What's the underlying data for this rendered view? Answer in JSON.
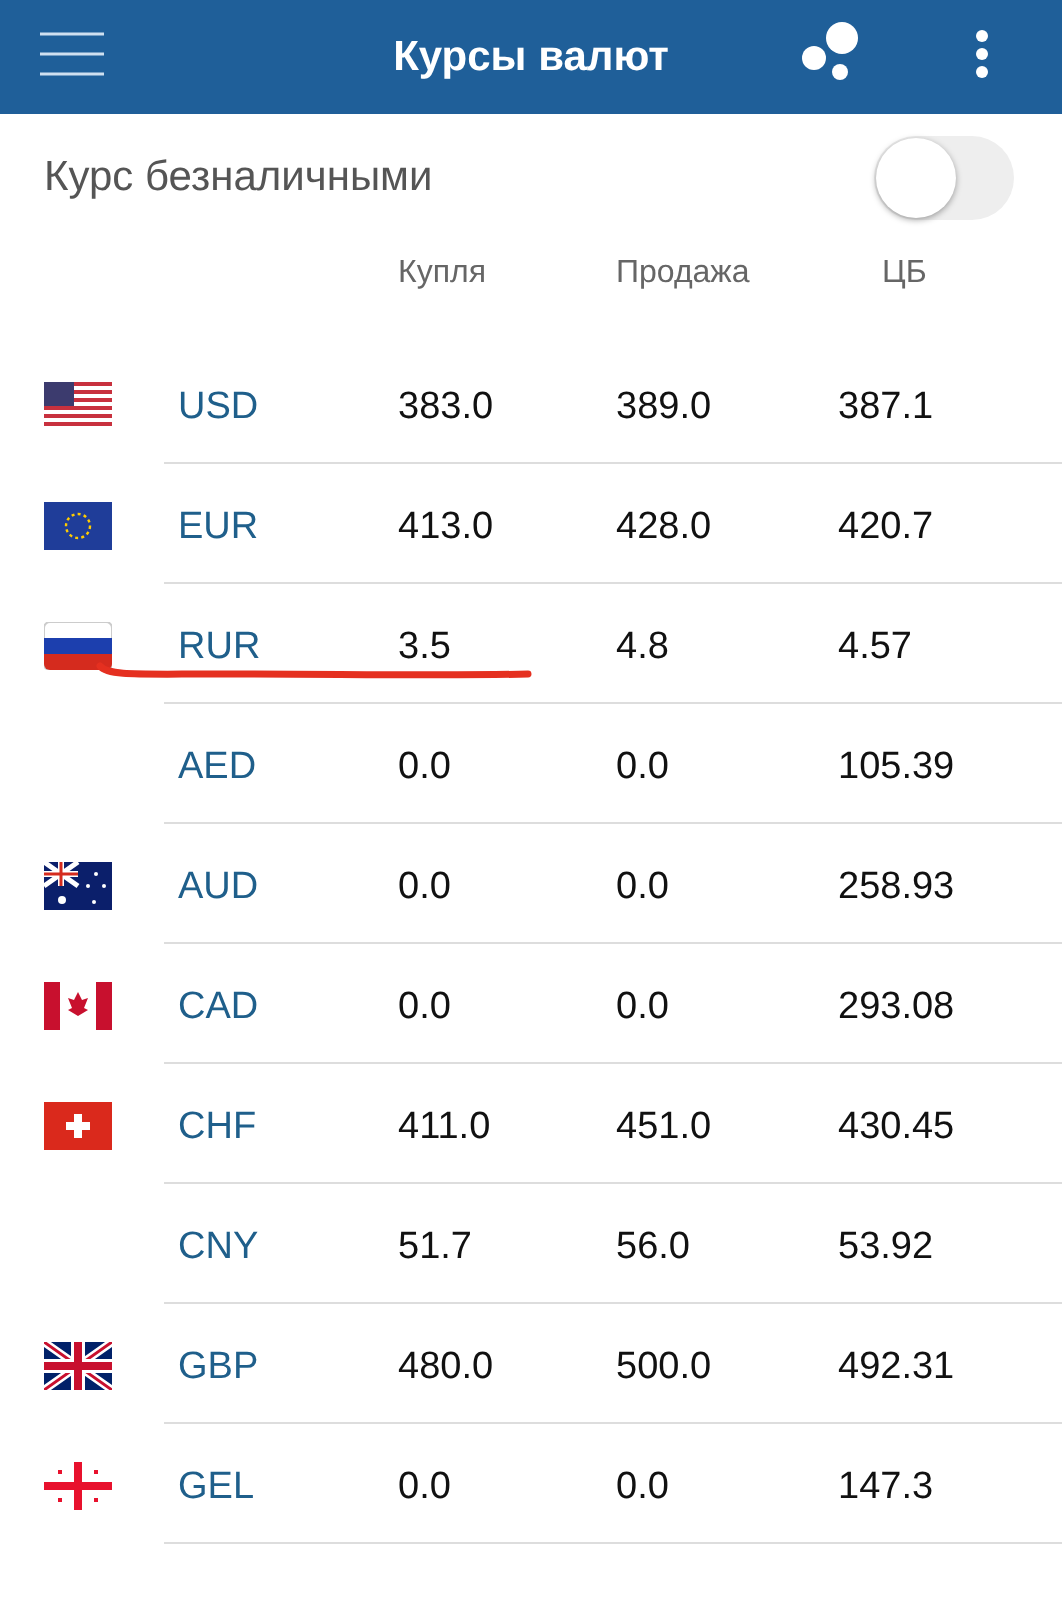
{
  "app_bar": {
    "title": "Курсы валют"
  },
  "cashless_toggle": {
    "label": "Курс безналичными",
    "on": false
  },
  "table": {
    "columns": [
      "Купля",
      "Продажа",
      "ЦБ"
    ],
    "rows": [
      {
        "kind": "us",
        "code": "USD",
        "buy": "383.0",
        "sell": "389.0",
        "cb": "387.1",
        "marked": false
      },
      {
        "kind": "eu",
        "code": "EUR",
        "buy": "413.0",
        "sell": "428.0",
        "cb": "420.7",
        "marked": false
      },
      {
        "kind": "ru",
        "code": "RUR",
        "buy": "3.5",
        "sell": "4.8",
        "cb": "4.57",
        "marked": true
      },
      {
        "code": "AED",
        "buy": "0.0",
        "sell": "0.0",
        "cb": "105.39",
        "marked": false
      },
      {
        "kind": "au",
        "code": "AUD",
        "buy": "0.0",
        "sell": "0.0",
        "cb": "258.93",
        "marked": false
      },
      {
        "kind": "ca",
        "code": "CAD",
        "buy": "0.0",
        "sell": "0.0",
        "cb": "293.08",
        "marked": false
      },
      {
        "kind": "ch",
        "code": "CHF",
        "buy": "411.0",
        "sell": "451.0",
        "cb": "430.45",
        "marked": false
      },
      {
        "code": "CNY",
        "buy": "51.7",
        "sell": "56.0",
        "cb": "53.92",
        "marked": false
      },
      {
        "kind": "gb",
        "code": "GBP",
        "buy": "480.0",
        "sell": "500.0",
        "cb": "492.31",
        "marked": false
      },
      {
        "kind": "ge",
        "code": "GEL",
        "buy": "0.0",
        "sell": "0.0",
        "cb": "147.3",
        "marked": false
      }
    ]
  }
}
